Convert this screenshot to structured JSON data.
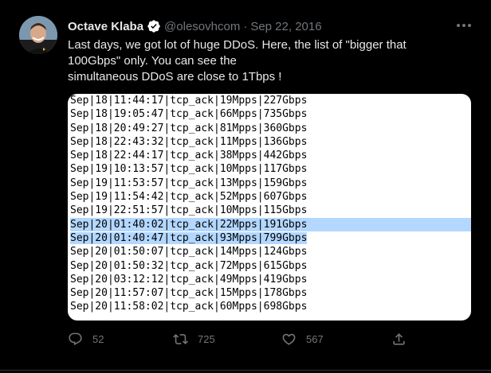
{
  "tweet": {
    "author_name": "Octave Klaba",
    "handle": "@olesovhcom",
    "separator": "·",
    "date": "Sep 22, 2016",
    "text_lines": [
      "Last days, we got lot of huge DDoS. Here, the list of \"bigger that",
      "100Gbps\" only. You can see the",
      "simultaneous DDoS are close to 1Tbps !"
    ],
    "verified": true,
    "log_lines": [
      "Sep|18|11:44:17|tcp_ack|19Mpps|227Gbps",
      "Sep|18|19:05:47|tcp_ack|66Mpps|735Gbps",
      "Sep|18|20:49:27|tcp_ack|81Mpps|360Gbps",
      "Sep|18|22:43:32|tcp_ack|11Mpps|136Gbps",
      "Sep|18|22:44:17|tcp_ack|38Mpps|442Gbps",
      "Sep|19|10:13:57|tcp_ack|10Mpps|117Gbps",
      "Sep|19|11:53:57|tcp_ack|13Mpps|159Gbps",
      "Sep|19|11:54:42|tcp_ack|52Mpps|607Gbps",
      "Sep|19|22:51:57|tcp_ack|10Mpps|115Gbps",
      "Sep|20|01:40:02|tcp_ack|22Mpps|191Gbps",
      "Sep|20|01:40:47|tcp_ack|93Mpps|799Gbps",
      "Sep|20|01:50:07|tcp_ack|14Mpps|124Gbps",
      "Sep|20|01:50:32|tcp_ack|72Mpps|615Gbps",
      "Sep|20|03:12:12|tcp_ack|49Mpps|419Gbps",
      "Sep|20|11:57:07|tcp_ack|15Mpps|178Gbps",
      "Sep|20|11:58:02|tcp_ack|60Mpps|698Gbps"
    ],
    "highlight_color": "#b3d7ff",
    "actions": {
      "reply_count": "52",
      "retweet_count": "725",
      "like_count": "567"
    }
  },
  "colors": {
    "background": "#000000",
    "text_primary": "#e7e9ea",
    "text_secondary": "#71767b",
    "verified": "#ffffff"
  },
  "icons": [
    "verified-badge-icon",
    "more-icon",
    "reply-icon",
    "retweet-icon",
    "like-icon",
    "share-icon"
  ]
}
